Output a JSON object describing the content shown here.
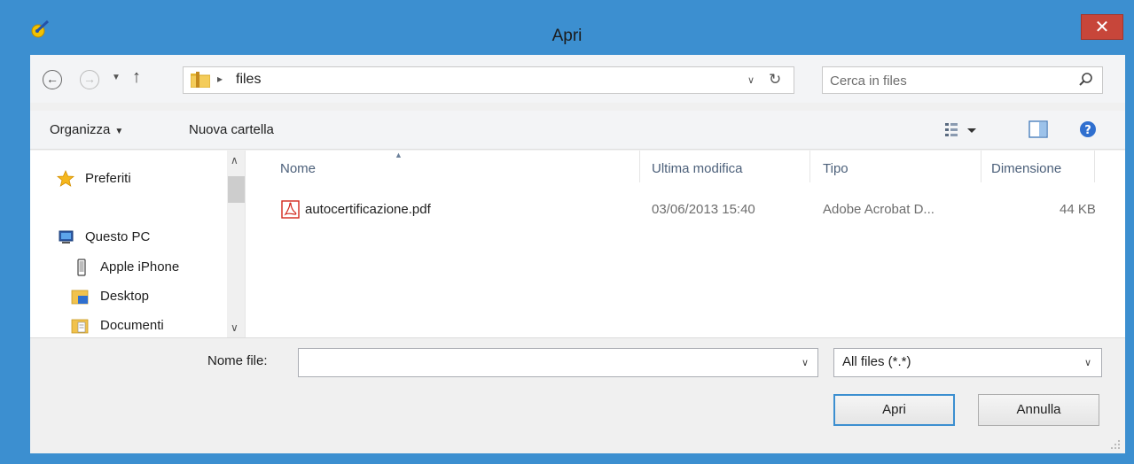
{
  "window": {
    "title": "Apri",
    "close_label": "✕"
  },
  "address": {
    "folder": "files",
    "separator": "▸"
  },
  "search": {
    "placeholder": "Cerca in files"
  },
  "toolbar": {
    "organize_label": "Organizza",
    "new_folder_label": "Nuova cartella"
  },
  "nav": {
    "items": [
      {
        "label": "Preferiti",
        "icon": "star-icon"
      },
      {
        "label": "Questo PC",
        "icon": "computer-icon"
      },
      {
        "label": "Apple iPhone",
        "icon": "phone-icon"
      },
      {
        "label": "Desktop",
        "icon": "desktop-folder-icon"
      },
      {
        "label": "Documenti",
        "icon": "documents-folder-icon"
      }
    ]
  },
  "files": {
    "columns": [
      "Nome",
      "Ultima modifica",
      "Tipo",
      "Dimensione"
    ],
    "rows": [
      {
        "name": "autocertificazione.pdf",
        "modified": "03/06/2013 15:40",
        "type": "Adobe Acrobat D...",
        "size": "44 KB",
        "icon": "pdf-icon"
      }
    ]
  },
  "bottom": {
    "filename_label": "Nome file:",
    "filename_value": "",
    "filter_value": "All files (*.*)",
    "open_label": "Apri",
    "cancel_label": "Annulla"
  },
  "colors": {
    "frame": "#3c8fd0",
    "close": "#c7463a",
    "header_text": "#4c607a",
    "pdf_red": "#d2261b"
  }
}
